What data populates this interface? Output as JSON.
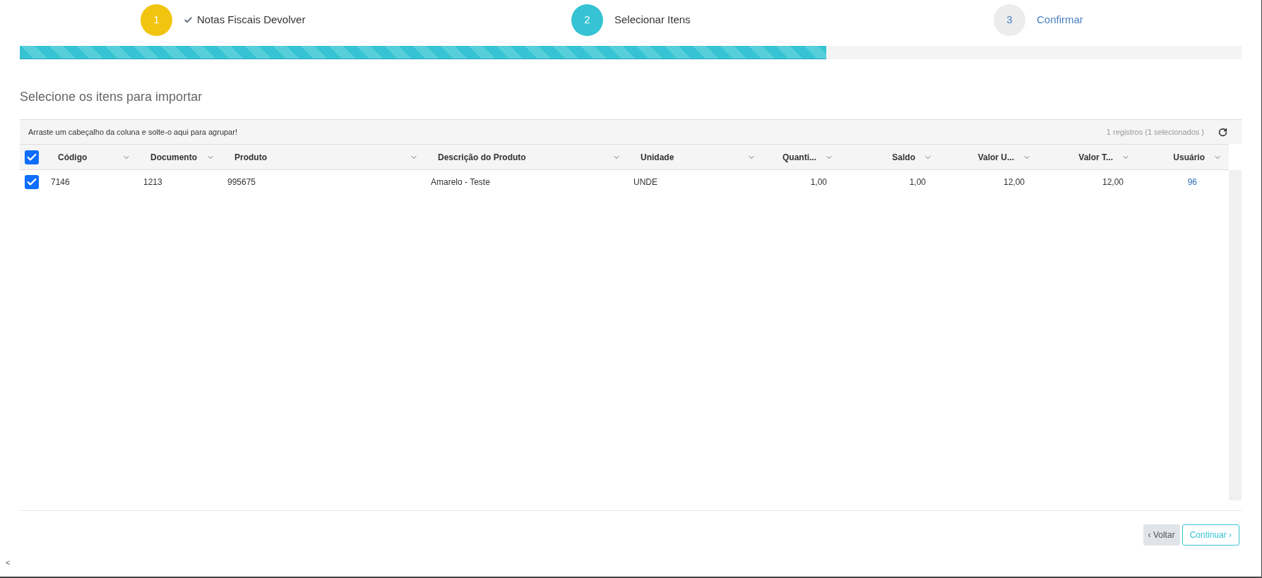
{
  "steps": [
    {
      "number": "1",
      "label": "Notas Fiscais Devolver",
      "kind": "done"
    },
    {
      "number": "2",
      "label": "Selecionar Itens",
      "kind": "active"
    },
    {
      "number": "3",
      "label": "Confirmar",
      "kind": "pending"
    }
  ],
  "progress": {
    "level": 0.66
  },
  "title": "Selecione os itens para importar",
  "grid": {
    "group_hint": "Arraste um cabeçalho da coluna e solte-o aqui para agrupar!",
    "record_count": "1 registros (1 selecionados )",
    "select_all_checked": true,
    "columns": [
      {
        "label": "Código",
        "kind": "text"
      },
      {
        "label": "Documento",
        "kind": "text"
      },
      {
        "label": "Produto",
        "kind": "text"
      },
      {
        "label": "Descrição do Produto",
        "kind": "text"
      },
      {
        "label": "Unidade",
        "kind": "text"
      },
      {
        "label": "Quanti...",
        "kind": "number"
      },
      {
        "label": "Saldo",
        "kind": "number"
      },
      {
        "label": "Valor U...",
        "kind": "number"
      },
      {
        "label": "Valor T...",
        "kind": "number"
      },
      {
        "label": "Usuário",
        "kind": "number"
      }
    ],
    "rows": [
      {
        "checked": true,
        "cells": [
          "7146",
          "1213",
          "995675",
          "Amarelo - Teste",
          "UNDE",
          "1,00",
          "1,00",
          "12,00",
          "12,00",
          "96"
        ]
      }
    ]
  },
  "buttons": {
    "back": "‹ Voltar",
    "next": "Continuar ›"
  },
  "corner": "<"
}
